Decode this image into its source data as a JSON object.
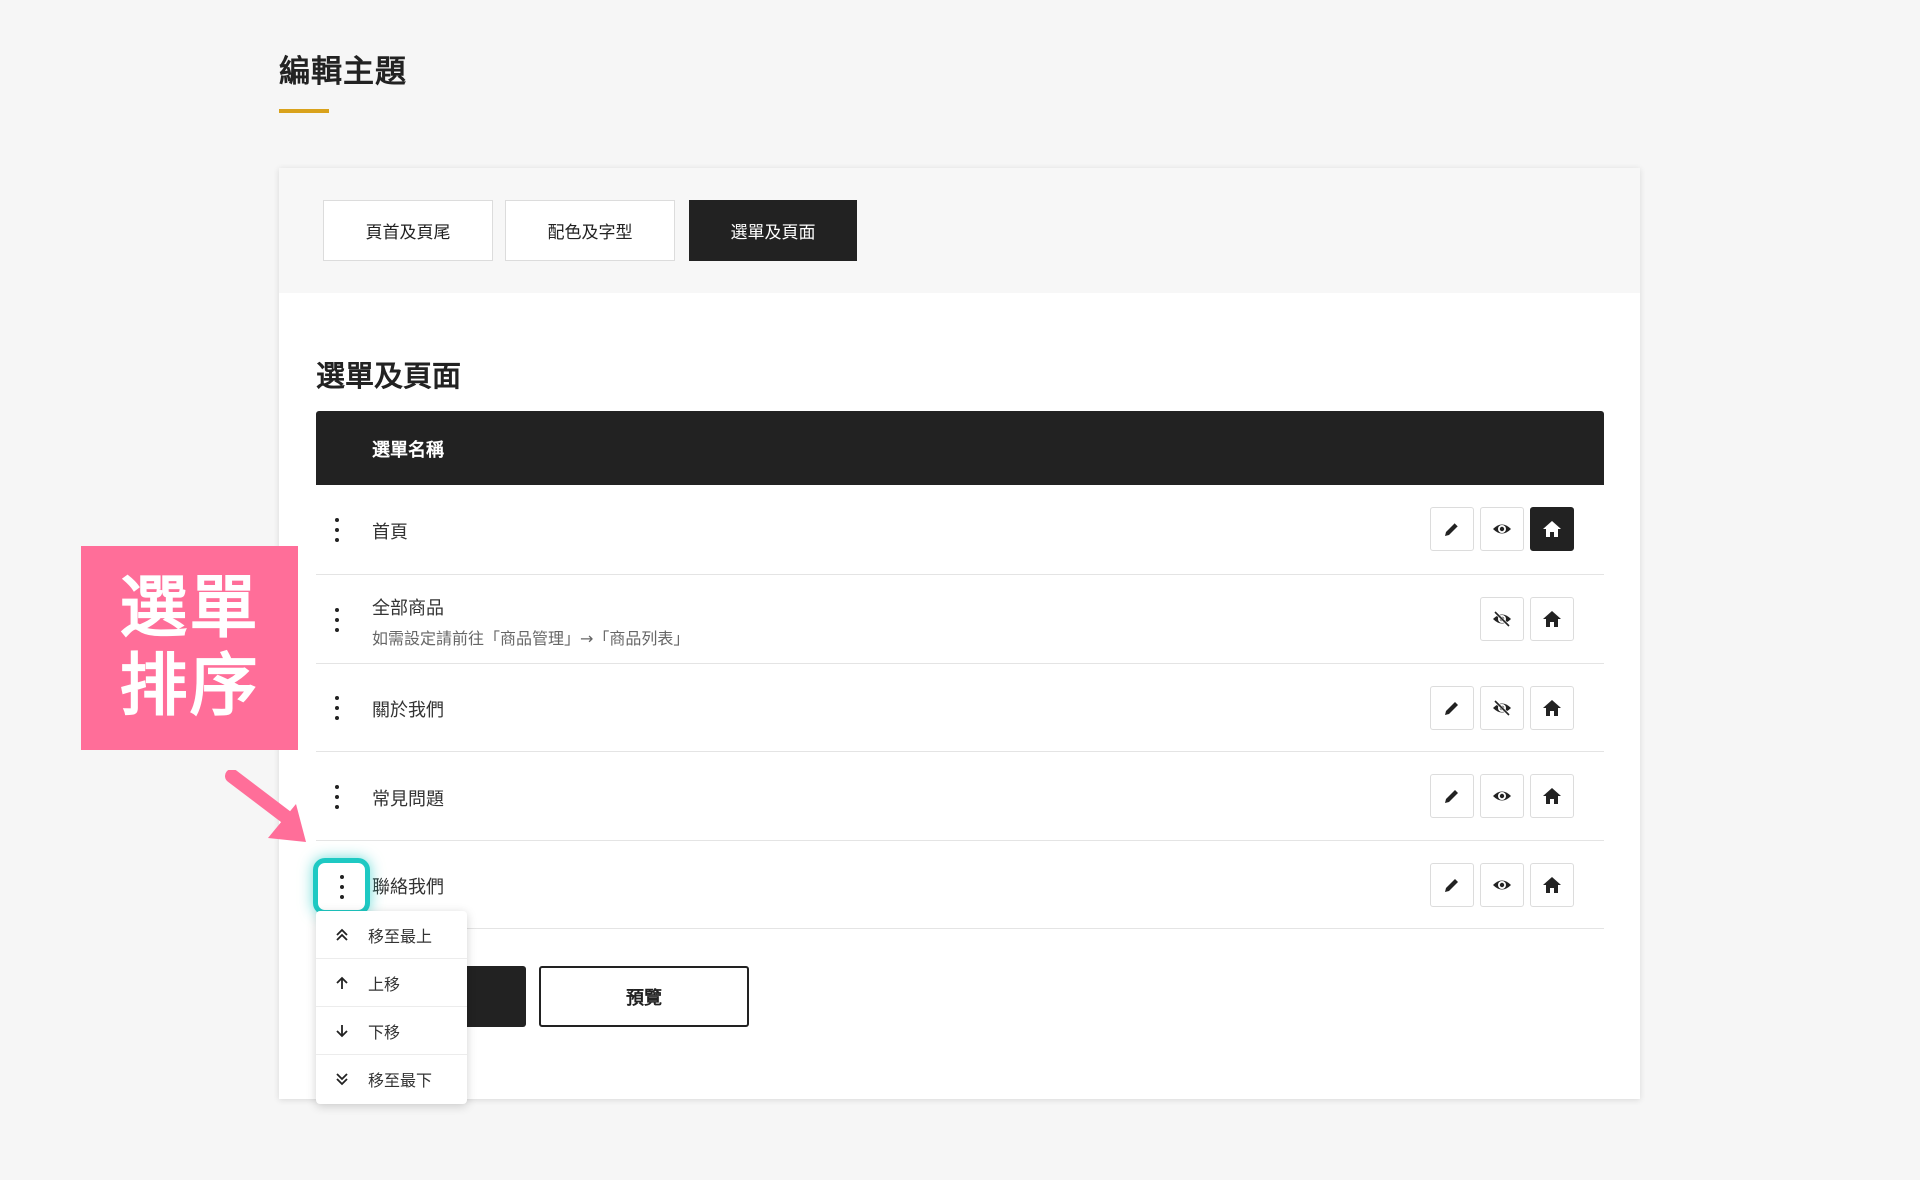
{
  "page": {
    "title": "編輯主題"
  },
  "tabs": [
    {
      "label": "頁首及頁尾"
    },
    {
      "label": "配色及字型"
    },
    {
      "label": "選單及頁面",
      "active": true
    }
  ],
  "section": {
    "title": "選單及頁面"
  },
  "table": {
    "header": "選單名稱",
    "rows": [
      {
        "name": "首頁",
        "actions": [
          "pencil-icon",
          "eye-icon",
          "home-icon"
        ],
        "home_active": true
      },
      {
        "name": "全部商品",
        "note": "如需設定請前往「商品管理」→「商品列表」",
        "actions": [
          "eye-slash-icon",
          "home-icon"
        ]
      },
      {
        "name": "關於我們",
        "actions": [
          "pencil-icon",
          "eye-slash-icon",
          "home-icon"
        ]
      },
      {
        "name": "常見問題",
        "actions": [
          "pencil-icon",
          "eye-icon",
          "home-icon"
        ]
      },
      {
        "name": "聯絡我們",
        "actions": [
          "pencil-icon",
          "eye-icon",
          "home-icon"
        ]
      }
    ]
  },
  "buttons": {
    "preview": "預覽"
  },
  "dropdown": {
    "items": [
      {
        "label": "移至最上",
        "icon": "double-chevron-up-icon"
      },
      {
        "label": "上移",
        "icon": "arrow-up-icon"
      },
      {
        "label": "下移",
        "icon": "arrow-down-icon"
      },
      {
        "label": "移至最下",
        "icon": "double-chevron-down-icon"
      }
    ]
  },
  "annotation": {
    "line1": "選單",
    "line2": "排序"
  },
  "colors": {
    "accent": "#d9a21b",
    "dark": "#222222",
    "highlight": "#1ec9c3",
    "annotation": "#ff6e99"
  }
}
